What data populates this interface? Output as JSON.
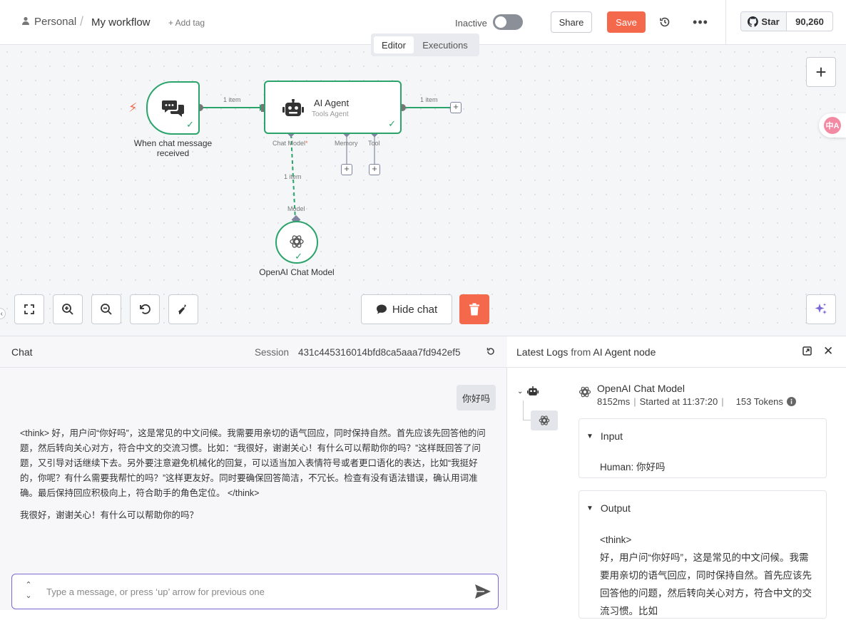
{
  "header": {
    "project": "Personal",
    "separator": "/",
    "workflow_name": "My workflow",
    "add_tag": "+ Add tag",
    "status_label": "Inactive",
    "share_label": "Share",
    "save_label": "Save",
    "more_label": "•••",
    "github_star": "Star",
    "github_count": "90,260"
  },
  "tabs": {
    "editor": "Editor",
    "executions": "Executions"
  },
  "canvas": {
    "trigger_node": {
      "label": "When chat message received"
    },
    "agent_node": {
      "title": "AI Agent",
      "subtitle": "Tools Agent"
    },
    "model_node": {
      "label": "OpenAI Chat Model"
    },
    "edge_labels": {
      "trigger_to_agent": "1 item",
      "agent_out": "1 item",
      "model_link": "1 item"
    },
    "ports": {
      "chat_model": "Chat Model",
      "required_mark": "*",
      "memory": "Memory",
      "tool": "Tool",
      "model": "Model"
    },
    "hide_chat_label": "Hide chat",
    "translate_badge": "中A"
  },
  "chat": {
    "title": "Chat",
    "session_label": "Session",
    "session_id": "431c445316014bfd8ca5aaa7fd942ef5",
    "user_message": "你好吗",
    "bot_think": "<think> 好，用户问“你好吗”，这是常见的中文问候。我需要用亲切的语气回应，同时保持自然。首先应该先回答他的问题，然后转向关心对方，符合中文的交流习惯。比如：“我很好，谢谢关心！有什么可以帮助你的吗？”这样既回答了问题，又引导对话继续下去。另外要注意避免机械化的回复，可以适当加入表情符号或者更口语化的表达，比如“我挺好的，你呢？有什么需要我帮忙的吗？”这样更友好。同时要确保回答简洁，不冗长。检查有没有语法错误，确认用词准确。最后保持回应积极向上，符合助手的角色定位。 </think>",
    "bot_reply": "我很好，谢谢关心！有什么可以帮助你的吗？",
    "input_placeholder": "Type a message, or press ‘up’ arrow for previous one"
  },
  "logs": {
    "title_prefix": "Latest Logs",
    "title_mid": " from ",
    "title_node": "AI Agent node",
    "run": {
      "name": "OpenAI Chat Model",
      "duration": "8152ms",
      "started": "Started at 11:37:20",
      "tokens": "153 Tokens"
    },
    "input": {
      "label": "Input",
      "text": "Human: 你好吗"
    },
    "output": {
      "label": "Output",
      "think_tag": "<think>",
      "text": "好，用户问“你好吗”，这是常见的中文问候。我需要用亲切的语气回应，同时保持自然。首先应该先回答他的问题，然后转向关心对方，符合中文的交流习惯。比如"
    }
  },
  "colors": {
    "accent": "#f4694c",
    "success": "#2aa46a",
    "input_focus": "#7b6ad6"
  }
}
